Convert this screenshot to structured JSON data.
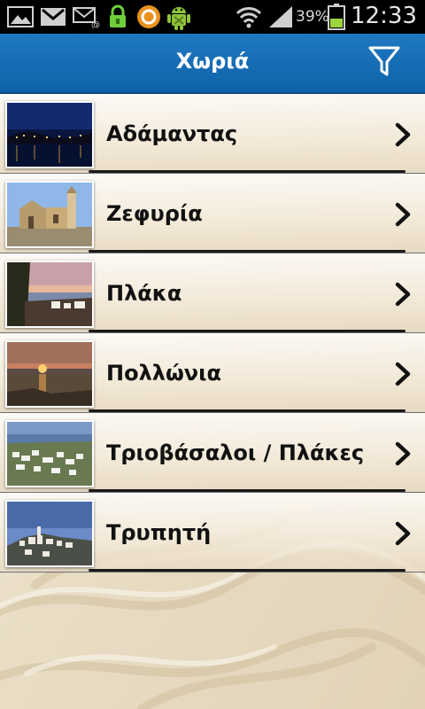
{
  "status_bar": {
    "icons": [
      "gallery-icon",
      "gmail-icon",
      "email-icon",
      "lock-icon",
      "app-icon",
      "android-debug-icon",
      "wifi-icon",
      "signal-icon",
      "battery-icon"
    ],
    "battery_percent": "39%",
    "time": "12:33"
  },
  "app_bar": {
    "title": "Χωριά",
    "filter_icon": "filter-icon"
  },
  "villages": [
    {
      "name": "Αδάμαντας",
      "thumb": "night-harbor"
    },
    {
      "name": "Ζεφυρία",
      "thumb": "stone-church"
    },
    {
      "name": "Πλάκα",
      "thumb": "sunset-terrace"
    },
    {
      "name": "Πολλώνια",
      "thumb": "sea-sunset"
    },
    {
      "name": "Τριοβάσαλοι / Πλάκες",
      "thumb": "hill-village"
    },
    {
      "name": "Τρυπητή",
      "thumb": "town-dusk"
    }
  ],
  "colors": {
    "app_bar": "#1670b8",
    "background_sand": "#ede3cf",
    "label": "#111111"
  }
}
